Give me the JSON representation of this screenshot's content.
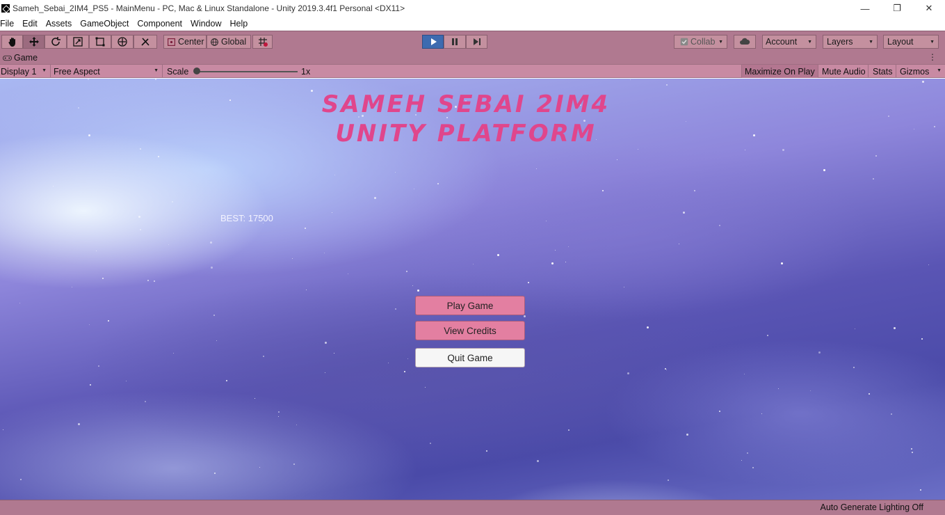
{
  "window": {
    "title": "Sameh_Sebai_2IM4_PS5 - MainMenu - PC, Mac & Linux Standalone - Unity 2019.3.4f1 Personal <DX11>",
    "minimize": "—",
    "maximize": "❐",
    "close": "✕"
  },
  "menu": [
    "File",
    "Edit",
    "Assets",
    "GameObject",
    "Component",
    "Window",
    "Help"
  ],
  "toolbar": {
    "center_label": "Center",
    "global_label": "Global",
    "collab_label": "Collab",
    "account_label": "Account",
    "layers_label": "Layers",
    "layout_label": "Layout"
  },
  "game_tab": {
    "label": "Game",
    "kebab": "⋮"
  },
  "game_controls": {
    "display": "Display 1",
    "aspect": "Free Aspect",
    "scale_label": "Scale",
    "scale_value": "1x",
    "maximize_on_play": "Maximize On Play",
    "mute_audio": "Mute Audio",
    "stats": "Stats",
    "gizmos": "Gizmos"
  },
  "game": {
    "title_line1": "SAMEH SEBAI 2IM4",
    "title_line2": "UNITY PLATFORM",
    "best": "BEST: 17500",
    "buttons": {
      "play": "Play Game",
      "credits": "View Credits",
      "quit": "Quit Game"
    }
  },
  "status": {
    "text": "Auto Generate Lighting Off"
  },
  "colors": {
    "toolbar_bg": "#b07990",
    "controls_bg": "#c88aa3",
    "title_pink": "#e0468c",
    "button_pink": "#e37fa1",
    "play_blue": "#3d6bb0"
  }
}
